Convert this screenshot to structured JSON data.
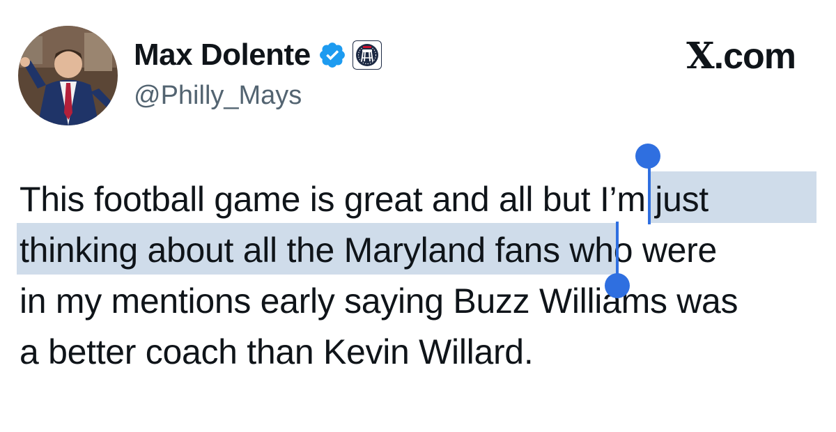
{
  "user": {
    "display_name": "Max Dolente",
    "handle": "@Philly_Mays",
    "verified": true,
    "affiliate_badge": "barstool-stool-badge"
  },
  "header": {
    "site_label": ".com",
    "site_logo": "X"
  },
  "tweet": {
    "line1_plain": "This football game is great and all but ",
    "line1_selected": "I’m just",
    "line2_selected": "thinking about all the Maryland fans",
    "line2_plain": " who were",
    "line3": "in my mentions early saying Buzz Williams was",
    "line4": "a better coach than Kevin Willard."
  },
  "colors": {
    "text": "#0f1419",
    "secondary_text": "#536471",
    "verified_blue": "#1d9bf0",
    "selection_highlight": "#cfdcea",
    "selection_handle": "#2f6fe0"
  }
}
